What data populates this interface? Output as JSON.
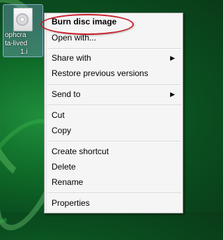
{
  "desktop_icon": {
    "label_lines": [
      "ophcra",
      "ta-lived",
      "1.i"
    ]
  },
  "context_menu": {
    "items": [
      {
        "label": "Burn disc image",
        "submenu": false,
        "bold": true
      },
      {
        "label": "Open with...",
        "submenu": false
      },
      {
        "label": "Share with",
        "submenu": true
      },
      {
        "label": "Restore previous versions",
        "submenu": false
      },
      {
        "label": "Send to",
        "submenu": true
      },
      {
        "label": "Cut",
        "submenu": false
      },
      {
        "label": "Copy",
        "submenu": false
      },
      {
        "label": "Create shortcut",
        "submenu": false
      },
      {
        "label": "Delete",
        "submenu": false
      },
      {
        "label": "Rename",
        "submenu": false
      },
      {
        "label": "Properties",
        "submenu": false
      }
    ],
    "submenu_arrow": "▶"
  },
  "highlight_color": "#c8202a"
}
